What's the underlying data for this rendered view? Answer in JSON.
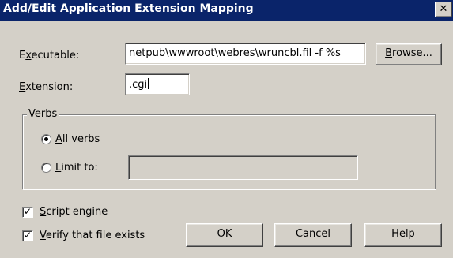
{
  "window": {
    "title": "Add/Edit Application Extension Mapping",
    "close_glyph": "✕"
  },
  "executable": {
    "label_before": "E",
    "label_accel": "x",
    "label_after": "ecutable:",
    "value": "netpub\\wwwroot\\webres\\wruncbl.fil -f %s",
    "browse_accel": "B",
    "browse_rest": "rowse..."
  },
  "extension": {
    "label_accel": "E",
    "label_after": "xtension:",
    "value": ".cgi"
  },
  "verbs": {
    "legend": "Verbs",
    "all_accel": "A",
    "all_rest": "ll verbs",
    "all_selected": true,
    "limit_accel": "L",
    "limit_rest": "imit to:",
    "limit_selected": false,
    "limit_value": ""
  },
  "options": {
    "script_accel": "S",
    "script_rest": "cript engine",
    "script_checked": true,
    "verify_accel": "V",
    "verify_rest": "erify that file exists",
    "verify_checked": true,
    "check_glyph": "✓"
  },
  "buttons": {
    "ok": "OK",
    "cancel": "Cancel",
    "help": "Help"
  }
}
